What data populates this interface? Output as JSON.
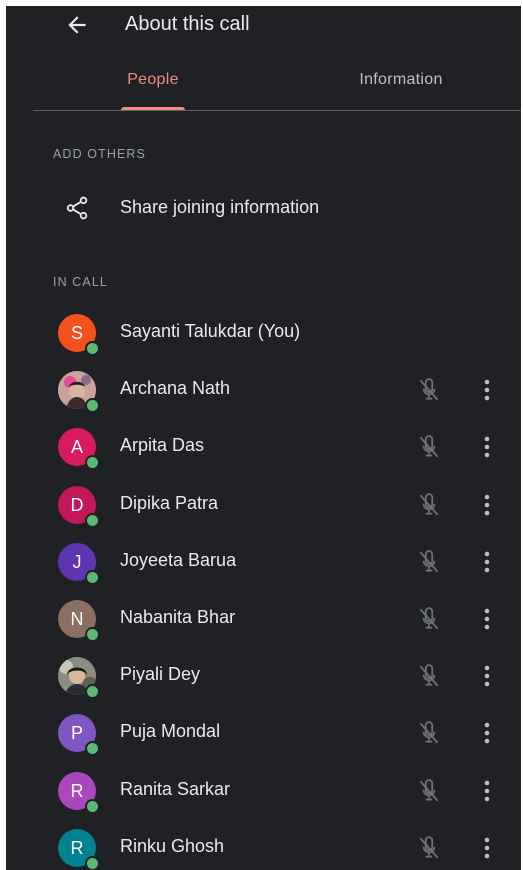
{
  "header": {
    "title": "About this call",
    "back_icon": "arrow-back-icon"
  },
  "tabs": [
    {
      "label": "People",
      "active": true
    },
    {
      "label": "Information",
      "active": false
    }
  ],
  "colors": {
    "background": "#202124",
    "accent": "#f28b82",
    "online": "#5bb974",
    "text_primary": "#e8eaed",
    "text_secondary": "#9aa0a6"
  },
  "add_others": {
    "label": "ADD OTHERS",
    "share": {
      "icon": "share-icon",
      "label": "Share joining information"
    }
  },
  "in_call": {
    "label": "IN CALL",
    "participants": [
      {
        "name": "Sayanti Talukdar (You)",
        "initial": "S",
        "color": "#f4511e",
        "photo": false,
        "self": true
      },
      {
        "name": "Archana Nath",
        "initial": "",
        "color": "#a1887f",
        "photo": true,
        "self": false
      },
      {
        "name": "Arpita Das",
        "initial": "A",
        "color": "#d81b60",
        "photo": false,
        "self": false
      },
      {
        "name": "Dipika Patra",
        "initial": "D",
        "color": "#c2185b",
        "photo": false,
        "self": false
      },
      {
        "name": "Joyeeta Barua",
        "initial": "J",
        "color": "#5e35b1",
        "photo": false,
        "self": false
      },
      {
        "name": "Nabanita Bhar",
        "initial": "N",
        "color": "#8d6e63",
        "photo": false,
        "self": false
      },
      {
        "name": "Piyali Dey",
        "initial": "",
        "color": "#6d6d6d",
        "photo": true,
        "self": false
      },
      {
        "name": "Puja Mondal",
        "initial": "P",
        "color": "#7e57c2",
        "photo": false,
        "self": false
      },
      {
        "name": "Ranita Sarkar",
        "initial": "R",
        "color": "#ab47bc",
        "photo": false,
        "self": false
      },
      {
        "name": "Rinku Ghosh",
        "initial": "R",
        "color": "#00838f",
        "photo": false,
        "self": false
      }
    ]
  }
}
